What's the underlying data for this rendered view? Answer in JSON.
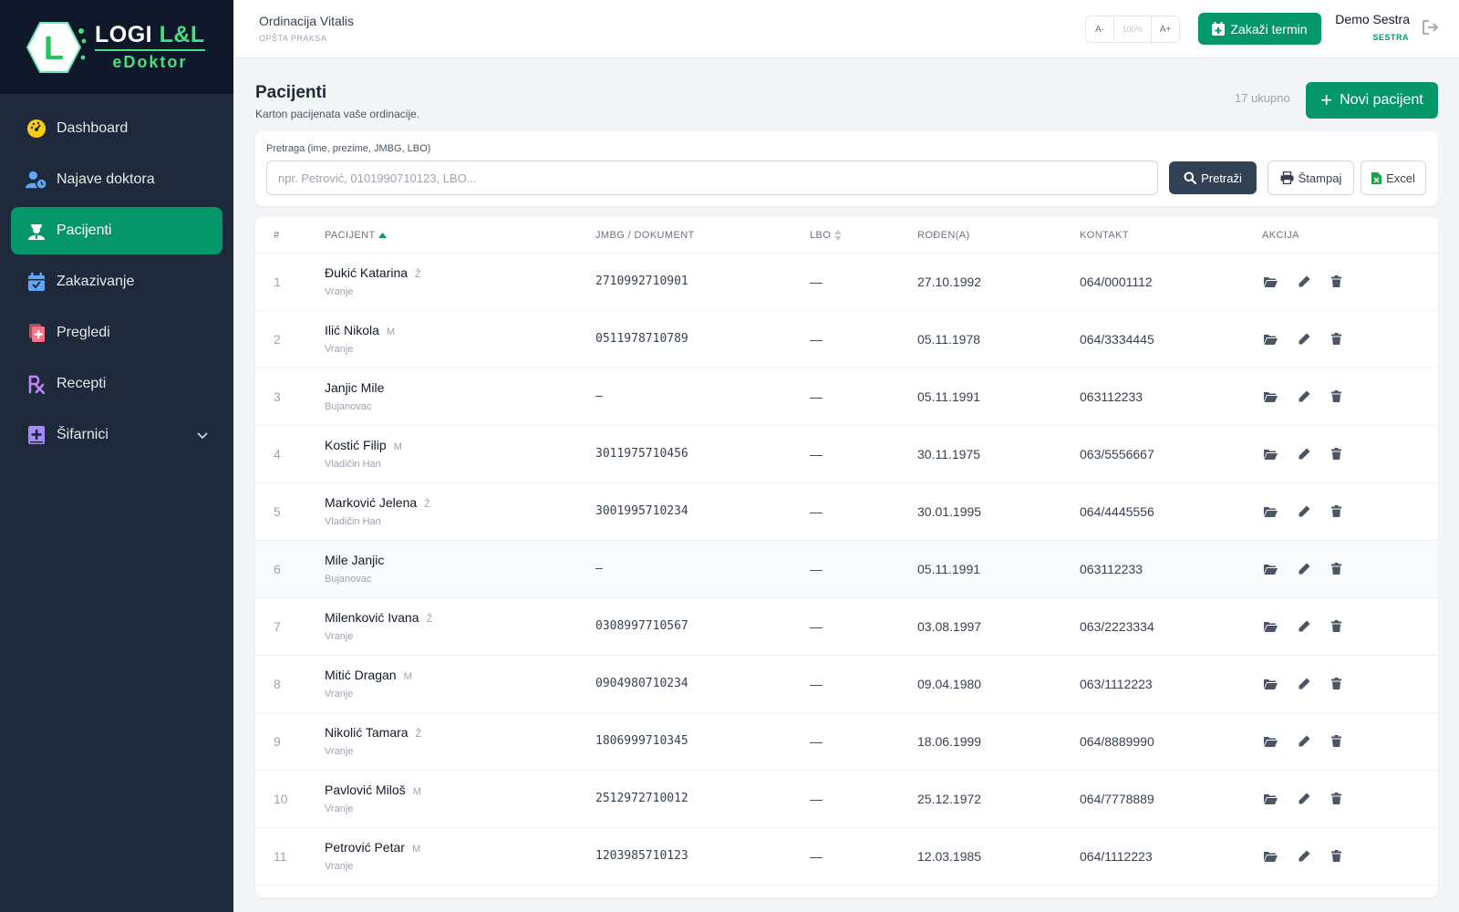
{
  "brand": {
    "logo_letter": "L",
    "name_prefix": "LOGI",
    "name_accent": "L&L",
    "product": "eDoktor"
  },
  "sidebar": {
    "items": [
      {
        "label": "Dashboard",
        "icon": "gauge-icon",
        "color": "#facc15"
      },
      {
        "label": "Najave doktora",
        "icon": "user-clock-icon",
        "color": "#60a5fa"
      },
      {
        "label": "Pacijenti",
        "icon": "patient-icon",
        "color": "#ffffff",
        "active": true
      },
      {
        "label": "Zakazivanje",
        "icon": "calendar-icon",
        "color": "#60a5fa"
      },
      {
        "label": "Pregledi",
        "icon": "medical-file-icon",
        "color": "#fb7185"
      },
      {
        "label": "Recepti",
        "icon": "prescription-icon",
        "color": "#c084fc"
      },
      {
        "label": "Šifarnici",
        "icon": "medical-book-icon",
        "color": "#a78bfa",
        "has_submenu": true
      }
    ]
  },
  "header": {
    "clinic_name": "Ordinacija Vitalis",
    "clinic_type": "OPŠTA PRAKSA",
    "zoom_minus": "A-",
    "zoom_value": "100%",
    "zoom_plus": "A+",
    "schedule_label": "Zakaži termin",
    "user_name": "Demo Sestra",
    "user_role": "SESTRA"
  },
  "page": {
    "title": "Pacijenti",
    "subtitle": "Karton pacijenata vaše ordinacije.",
    "total": "17 ukupno",
    "new_label": "Novi pacijent"
  },
  "search": {
    "label": "Pretraga (ime, prezime, JMBG, LBO)",
    "placeholder": "npr. Petrović, 0101990710123, LBO...",
    "value": "",
    "search_label": "Pretraži",
    "print_label": "Štampaj",
    "excel_label": "Excel"
  },
  "table": {
    "columns": [
      "#",
      "PACIJENT",
      "JMBG / DOKUMENT",
      "LBO",
      "ROĐEN(A)",
      "KONTAKT",
      "AKCIJA"
    ],
    "rows": [
      {
        "idx": "1",
        "name": "Đukić Katarina",
        "sex": "Ž",
        "city": "Vranje",
        "jmbg": "2710992710901",
        "lbo": "—",
        "dob": "27.10.1992",
        "contact": "064/0001112"
      },
      {
        "idx": "2",
        "name": "Ilić Nikola",
        "sex": "M",
        "city": "Vranje",
        "jmbg": "0511978710789",
        "lbo": "—",
        "dob": "05.11.1978",
        "contact": "064/3334445"
      },
      {
        "idx": "3",
        "name": "Janjic Mile",
        "sex": "",
        "city": "Bujanovac",
        "jmbg": "—",
        "lbo": "—",
        "dob": "05.11.1991",
        "contact": "063112233"
      },
      {
        "idx": "4",
        "name": "Kostić Filip",
        "sex": "M",
        "city": "Vladičin Han",
        "jmbg": "3011975710456",
        "lbo": "—",
        "dob": "30.11.1975",
        "contact": "063/5556667"
      },
      {
        "idx": "5",
        "name": "Marković Jelena",
        "sex": "Ž",
        "city": "Vladičin Han",
        "jmbg": "3001995710234",
        "lbo": "—",
        "dob": "30.01.1995",
        "contact": "064/4445556"
      },
      {
        "idx": "6",
        "name": "Mile Janjic",
        "sex": "",
        "city": "Bujanovac",
        "jmbg": "—",
        "lbo": "—",
        "dob": "05.11.1991",
        "contact": "063112233"
      },
      {
        "idx": "7",
        "name": "Milenković Ivana",
        "sex": "Ž",
        "city": "Vranje",
        "jmbg": "0308997710567",
        "lbo": "—",
        "dob": "03.08.1997",
        "contact": "063/2223334"
      },
      {
        "idx": "8",
        "name": "Mitić Dragan",
        "sex": "M",
        "city": "Vranje",
        "jmbg": "0904980710234",
        "lbo": "—",
        "dob": "09.04.1980",
        "contact": "063/1112223"
      },
      {
        "idx": "9",
        "name": "Nikolić Tamara",
        "sex": "Ž",
        "city": "Vranje",
        "jmbg": "1806999710345",
        "lbo": "—",
        "dob": "18.06.1999",
        "contact": "064/8889990"
      },
      {
        "idx": "10",
        "name": "Pavlović Miloš",
        "sex": "M",
        "city": "Vranje",
        "jmbg": "2512972710012",
        "lbo": "—",
        "dob": "25.12.1972",
        "contact": "064/7778889"
      },
      {
        "idx": "11",
        "name": "Petrović Petar",
        "sex": "M",
        "city": "Vranje",
        "jmbg": "1203985710123",
        "lbo": "—",
        "dob": "12.03.1985",
        "contact": "064/1112223"
      }
    ]
  },
  "colors": {
    "primary": "#059669",
    "sidebar": "#1e293b",
    "brand_bg": "#0f172a",
    "accent": "#4ade80"
  }
}
